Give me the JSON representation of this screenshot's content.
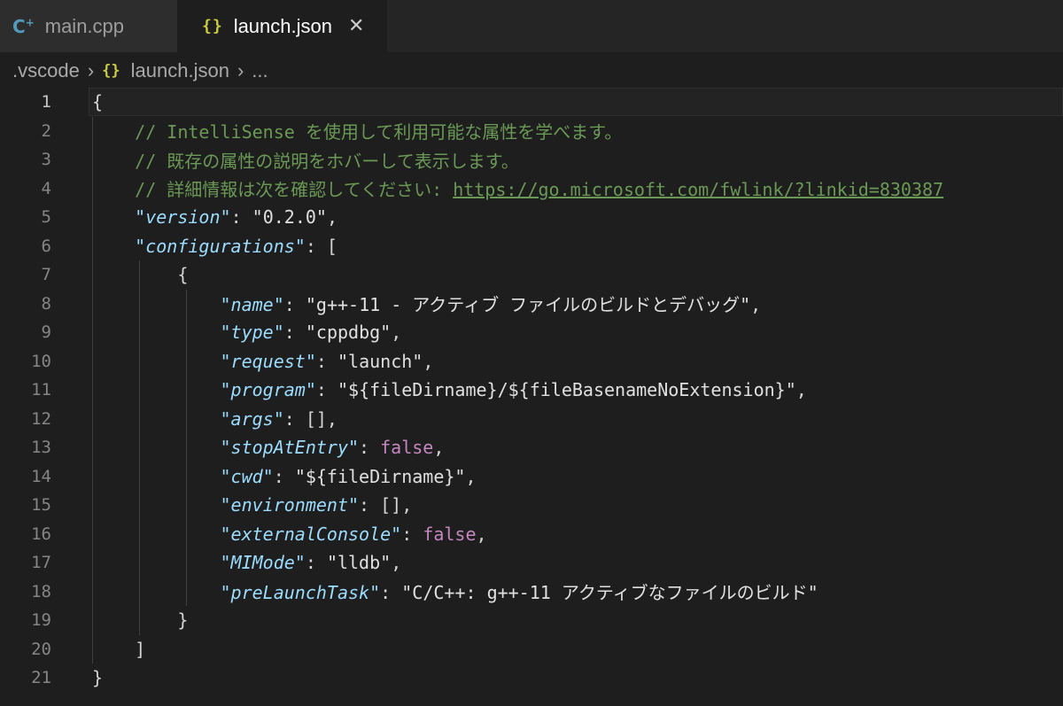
{
  "tabs": [
    {
      "icon": "cpp-icon",
      "label": "main.cpp",
      "active": false
    },
    {
      "icon": "json-icon",
      "label": "launch.json",
      "active": true
    }
  ],
  "breadcrumb": {
    "folder": ".vscode",
    "file": "launch.json",
    "more": "..."
  },
  "editor": {
    "current_line": 1,
    "lines": [
      {
        "n": "1",
        "tokens": [
          {
            "t": "{",
            "k": "punc"
          }
        ]
      },
      {
        "n": "2",
        "tokens": [
          {
            "t": "    ",
            "k": "punc"
          },
          {
            "t": "// IntelliSense を使用して利用可能な属性を学べます。",
            "k": "comment"
          }
        ]
      },
      {
        "n": "3",
        "tokens": [
          {
            "t": "    ",
            "k": "punc"
          },
          {
            "t": "// 既存の属性の説明をホバーして表示します。",
            "k": "comment"
          }
        ]
      },
      {
        "n": "4",
        "tokens": [
          {
            "t": "    ",
            "k": "punc"
          },
          {
            "t": "// 詳細情報は次を確認してください: ",
            "k": "comment"
          },
          {
            "t": "https://go.microsoft.com/fwlink/?linkid=830387",
            "k": "link"
          }
        ]
      },
      {
        "n": "5",
        "tokens": [
          {
            "t": "    ",
            "k": "punc"
          },
          {
            "t": "\"",
            "k": "keyq"
          },
          {
            "t": "version",
            "k": "key"
          },
          {
            "t": "\"",
            "k": "keyq"
          },
          {
            "t": ": ",
            "k": "punc"
          },
          {
            "t": "\"0.2.0\"",
            "k": "strw"
          },
          {
            "t": ",",
            "k": "punc"
          }
        ]
      },
      {
        "n": "6",
        "tokens": [
          {
            "t": "    ",
            "k": "punc"
          },
          {
            "t": "\"",
            "k": "keyq"
          },
          {
            "t": "configurations",
            "k": "key"
          },
          {
            "t": "\"",
            "k": "keyq"
          },
          {
            "t": ": [",
            "k": "punc"
          }
        ]
      },
      {
        "n": "7",
        "tokens": [
          {
            "t": "        {",
            "k": "punc"
          }
        ]
      },
      {
        "n": "8",
        "tokens": [
          {
            "t": "            ",
            "k": "punc"
          },
          {
            "t": "\"",
            "k": "keyq"
          },
          {
            "t": "name",
            "k": "key"
          },
          {
            "t": "\"",
            "k": "keyq"
          },
          {
            "t": ": ",
            "k": "punc"
          },
          {
            "t": "\"g++-11 - アクティブ ファイルのビルドとデバッグ\"",
            "k": "strw"
          },
          {
            "t": ",",
            "k": "punc"
          }
        ]
      },
      {
        "n": "9",
        "tokens": [
          {
            "t": "            ",
            "k": "punc"
          },
          {
            "t": "\"",
            "k": "keyq"
          },
          {
            "t": "type",
            "k": "key"
          },
          {
            "t": "\"",
            "k": "keyq"
          },
          {
            "t": ": ",
            "k": "punc"
          },
          {
            "t": "\"cppdbg\"",
            "k": "strw"
          },
          {
            "t": ",",
            "k": "punc"
          }
        ]
      },
      {
        "n": "10",
        "tokens": [
          {
            "t": "            ",
            "k": "punc"
          },
          {
            "t": "\"",
            "k": "keyq"
          },
          {
            "t": "request",
            "k": "key"
          },
          {
            "t": "\"",
            "k": "keyq"
          },
          {
            "t": ": ",
            "k": "punc"
          },
          {
            "t": "\"launch\"",
            "k": "strw"
          },
          {
            "t": ",",
            "k": "punc"
          }
        ]
      },
      {
        "n": "11",
        "tokens": [
          {
            "t": "            ",
            "k": "punc"
          },
          {
            "t": "\"",
            "k": "keyq"
          },
          {
            "t": "program",
            "k": "key"
          },
          {
            "t": "\"",
            "k": "keyq"
          },
          {
            "t": ": ",
            "k": "punc"
          },
          {
            "t": "\"${fileDirname}/${fileBasenameNoExtension}\"",
            "k": "strw"
          },
          {
            "t": ",",
            "k": "punc"
          }
        ]
      },
      {
        "n": "12",
        "tokens": [
          {
            "t": "            ",
            "k": "punc"
          },
          {
            "t": "\"",
            "k": "keyq"
          },
          {
            "t": "args",
            "k": "key"
          },
          {
            "t": "\"",
            "k": "keyq"
          },
          {
            "t": ": [],",
            "k": "punc"
          }
        ]
      },
      {
        "n": "13",
        "tokens": [
          {
            "t": "            ",
            "k": "punc"
          },
          {
            "t": "\"",
            "k": "keyq"
          },
          {
            "t": "stopAtEntry",
            "k": "key"
          },
          {
            "t": "\"",
            "k": "keyq"
          },
          {
            "t": ": ",
            "k": "punc"
          },
          {
            "t": "false",
            "k": "bool"
          },
          {
            "t": ",",
            "k": "punc"
          }
        ]
      },
      {
        "n": "14",
        "tokens": [
          {
            "t": "            ",
            "k": "punc"
          },
          {
            "t": "\"",
            "k": "keyq"
          },
          {
            "t": "cwd",
            "k": "key"
          },
          {
            "t": "\"",
            "k": "keyq"
          },
          {
            "t": ": ",
            "k": "punc"
          },
          {
            "t": "\"${fileDirname}\"",
            "k": "strw"
          },
          {
            "t": ",",
            "k": "punc"
          }
        ]
      },
      {
        "n": "15",
        "tokens": [
          {
            "t": "            ",
            "k": "punc"
          },
          {
            "t": "\"",
            "k": "keyq"
          },
          {
            "t": "environment",
            "k": "key"
          },
          {
            "t": "\"",
            "k": "keyq"
          },
          {
            "t": ": [],",
            "k": "punc"
          }
        ]
      },
      {
        "n": "16",
        "tokens": [
          {
            "t": "            ",
            "k": "punc"
          },
          {
            "t": "\"",
            "k": "keyq"
          },
          {
            "t": "externalConsole",
            "k": "key"
          },
          {
            "t": "\"",
            "k": "keyq"
          },
          {
            "t": ": ",
            "k": "punc"
          },
          {
            "t": "false",
            "k": "bool"
          },
          {
            "t": ",",
            "k": "punc"
          }
        ]
      },
      {
        "n": "17",
        "tokens": [
          {
            "t": "            ",
            "k": "punc"
          },
          {
            "t": "\"",
            "k": "keyq"
          },
          {
            "t": "MIMode",
            "k": "key"
          },
          {
            "t": "\"",
            "k": "keyq"
          },
          {
            "t": ": ",
            "k": "punc"
          },
          {
            "t": "\"lldb\"",
            "k": "strw"
          },
          {
            "t": ",",
            "k": "punc"
          }
        ]
      },
      {
        "n": "18",
        "tokens": [
          {
            "t": "            ",
            "k": "punc"
          },
          {
            "t": "\"",
            "k": "keyq"
          },
          {
            "t": "preLaunchTask",
            "k": "key"
          },
          {
            "t": "\"",
            "k": "keyq"
          },
          {
            "t": ": ",
            "k": "punc"
          },
          {
            "t": "\"C/C++: g++-11 アクティブなファイルのビルド\"",
            "k": "strw"
          }
        ]
      },
      {
        "n": "19",
        "tokens": [
          {
            "t": "        }",
            "k": "punc"
          }
        ]
      },
      {
        "n": "20",
        "tokens": [
          {
            "t": "    ]",
            "k": "punc"
          }
        ]
      },
      {
        "n": "21",
        "tokens": [
          {
            "t": "}",
            "k": "punc"
          }
        ]
      }
    ]
  },
  "colors": {
    "background": "#1e1e1e",
    "comment": "#6a9955",
    "key": "#9cdcfe",
    "string": "#e0e0e0",
    "boolean": "#c586c0",
    "json_icon": "#cbcb41",
    "cpp_icon": "#519aba"
  }
}
